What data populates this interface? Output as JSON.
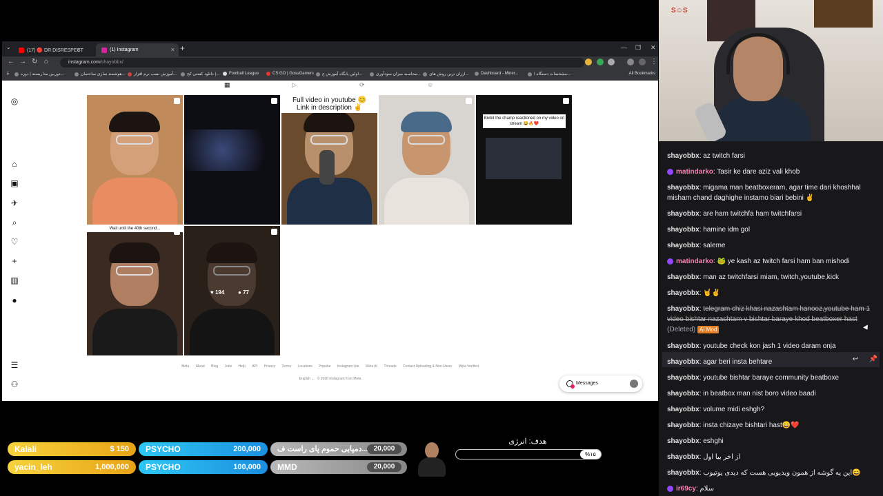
{
  "browser": {
    "tabs": [
      {
        "label": "(17) 🔴 DR DISRESPECT - TARI",
        "color": "#ff0000"
      },
      {
        "label": "(1) Instagram",
        "color": "#d6249f"
      }
    ],
    "url_domain": "instagram.com",
    "url_path": "/shayobbx/",
    "bookmarks": [
      {
        "label": "دوربین مداربسته | دوره..."
      },
      {
        "label": "هوشمند سازی ساختمان..."
      },
      {
        "label": "آموزش نصب نرم افزار..."
      },
      {
        "label": "دانلود کشتی کج |..."
      },
      {
        "label": "Football League"
      },
      {
        "label": "CS:GO | GosuGamers"
      },
      {
        "label": "اولین پایگاه آموزش ع..."
      },
      {
        "label": "محاسبه میزان سودآوری..."
      },
      {
        "label": "ارزان ترین روش های..."
      },
      {
        "label": "Dashboard - Miner..."
      },
      {
        "label": "مشخصات دستگاه ا..."
      }
    ],
    "all_bookmarks": "All Bookmarks"
  },
  "instagram": {
    "posts": [
      {
        "caption": "",
        "bg": "#c08a5a",
        "shirt": "#e98c62"
      },
      {
        "caption": "",
        "bg": "#0d0d14",
        "shirt": "#0d0d14"
      },
      {
        "caption": "Full video in youtube 😊\nLink in description ✌️",
        "bg": "#6b4b2e",
        "shirt": "#1f2f45"
      },
      {
        "caption": "",
        "bg": "#d8d4d0",
        "shirt": "#e8e4dd"
      },
      {
        "caption": "Bixbit the champ reactioned on my video on stream 😂🔥❤️",
        "bg": "#111",
        "shirt": "#111"
      },
      {
        "caption": "Wait until the 40th second...",
        "bg": "#3a2a22",
        "shirt": "#1a1a1a"
      },
      {
        "caption": "",
        "bg": "#2a201a",
        "shirt": "#141414",
        "likes": "194",
        "comments": "77"
      }
    ],
    "footer_links": [
      "Meta",
      "About",
      "Blog",
      "Jobs",
      "Help",
      "API",
      "Privacy",
      "Terms",
      "Locations",
      "Popular",
      "Instagram Lite",
      "Meta AI",
      "Threads",
      "Contact Uploading & Non-Users",
      "Meta Verified"
    ],
    "language": "English",
    "copyright": "© 2026 Instagram from Meta",
    "messages_label": "Messages"
  },
  "chat": [
    {
      "user": "shayobbx",
      "text": "az twitch farsi"
    },
    {
      "user": "matindarko",
      "text": "Tasir ke dare aziz vali khob",
      "mod": true
    },
    {
      "user": "shayobbx",
      "text": "migama man beatboxeram, agar time dari khoshhal misham chand daghighe instamo biari bebini ✌️"
    },
    {
      "user": "shayobbx",
      "text": "are ham twitchfa ham twitchfarsi"
    },
    {
      "user": "shayobbx",
      "text": "hamine idm gol"
    },
    {
      "user": "shayobbx",
      "text": "saleme"
    },
    {
      "user": "matindarko",
      "text": "🐸 ye kash az twitch farsi ham ban mishodi",
      "mod": true
    },
    {
      "user": "shayobbx",
      "text": "man az twitchfarsi miam, twitch,youtube,kick"
    },
    {
      "user": "shayobbx",
      "text": "🤘✌️"
    },
    {
      "user": "shayobbx",
      "text": "telegram chiz khasi nazashtam hanooz,youtube ham 1 video bishtar nazashtam v bishtar baraye khod beatboxer hast",
      "deleted": "(Deleted)",
      "tag": "AI Mod"
    },
    {
      "user": "shayobbx",
      "text": "youtube check kon jash 1 video daram onja"
    },
    {
      "user": "shayobbx",
      "text": "agar beri insta behtare"
    },
    {
      "user": "shayobbx",
      "text": "youtube bishtar baraye community beatboxe"
    },
    {
      "user": "shayobbx",
      "text": "in beatbox man nist boro video baadi"
    },
    {
      "user": "shayobbx",
      "text": "volume midi eshgh?"
    },
    {
      "user": "shayobbx",
      "text": "insta chizaye bishtari hast😄❤️"
    },
    {
      "user": "shayobbx",
      "text": "eshghi"
    },
    {
      "user": "shayobbx",
      "text": "از اخر بیا اول"
    },
    {
      "user": "shayobbx",
      "text": "این یه گوشه از همون ویدیویی هست که دیدی یوتیوب😄"
    },
    {
      "user": "ir69cy",
      "text": "سلام",
      "mod": true
    }
  ],
  "donations": {
    "top_left": [
      {
        "name": "Kalali",
        "amount": "$ 150"
      },
      {
        "name": "yacin_leh",
        "amount": "1,000,000"
      }
    ],
    "middle": [
      {
        "name": "PSYCHO",
        "amount": "200,000"
      },
      {
        "name": "PSYCHO",
        "amount": "100,000"
      }
    ],
    "right": [
      {
        "name": "دمپایی حموم پای راست ف...",
        "amount": "20,000"
      },
      {
        "name": "MMD",
        "amount": "20,000"
      }
    ]
  },
  "goal": {
    "title": "هدف: انرژی",
    "progress_label": "%۱۵",
    "progress": 0.15
  },
  "colors": {
    "chat_bg": "#18181b",
    "mod_name": "#ff7eb6",
    "ai_mod_tag": "#e67e22",
    "donation_yellow": "#f7d23c",
    "donation_blue": "#2ec7f2"
  }
}
